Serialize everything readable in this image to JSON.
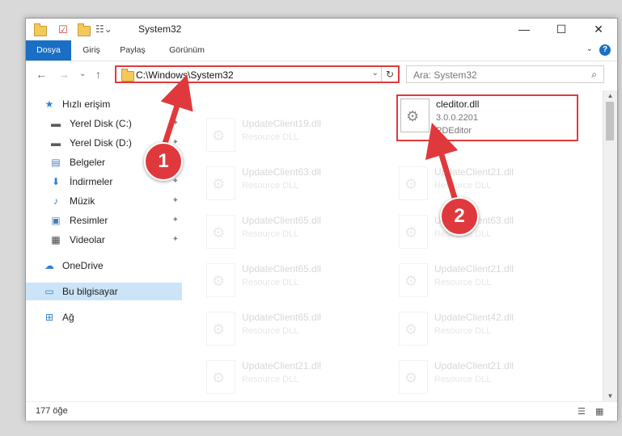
{
  "window": {
    "title": "System32",
    "minimize_glyph": "—",
    "maximize_glyph": "☐",
    "close_glyph": "✕"
  },
  "ribbon": {
    "tabs": [
      "Dosya",
      "Giriş",
      "Paylaş",
      "Görünüm"
    ],
    "help_glyph": "?",
    "expand_glyph": "⌄"
  },
  "navigation": {
    "back_glyph": "←",
    "forward_glyph": "→",
    "recent_glyph": "⌄",
    "up_glyph": "↑",
    "address": "C:\\Windows\\System32",
    "address_dropdown_glyph": "⌄",
    "refresh_glyph": "↻",
    "search_placeholder": "Ara: System32",
    "search_glyph": "⌕"
  },
  "sidebar": {
    "items": [
      {
        "label": "Hızlı erişim",
        "icon": "star-icon",
        "glyph": "★",
        "color": "#2f7fd6"
      },
      {
        "label": "Yerel Disk (C:)",
        "icon": "drive-icon",
        "glyph": "▬",
        "color": "#5a5a5a",
        "pinned": true
      },
      {
        "label": "Yerel Disk (D:)",
        "icon": "drive-icon",
        "glyph": "▬",
        "color": "#5a5a5a",
        "pinned": true
      },
      {
        "label": "Belgeler",
        "icon": "documents-icon",
        "glyph": "▤",
        "color": "#4a7bb7",
        "pinned": true
      },
      {
        "label": "İndirmeler",
        "icon": "download-icon",
        "glyph": "⬇",
        "color": "#2f7fd6",
        "pinned": true
      },
      {
        "label": "Müzik",
        "icon": "music-icon",
        "glyph": "♪",
        "color": "#2f7fd6",
        "pinned": true
      },
      {
        "label": "Resimler",
        "icon": "pictures-icon",
        "glyph": "▣",
        "color": "#4a7bb7",
        "pinned": true
      },
      {
        "label": "Videolar",
        "icon": "videos-icon",
        "glyph": "▦",
        "color": "#444",
        "pinned": true
      },
      {
        "label": "OneDrive",
        "icon": "cloud-icon",
        "glyph": "☁",
        "color": "#2f7fd6"
      },
      {
        "label": "Bu bilgisayar",
        "icon": "computer-icon",
        "glyph": "▭",
        "color": "#2f7fd6",
        "selected": true
      },
      {
        "label": "Ağ",
        "icon": "network-icon",
        "glyph": "⊞",
        "color": "#2f7fd6"
      }
    ],
    "pin_glyph": "✦"
  },
  "files": {
    "left_column": [
      {
        "name": "UpdateClient19.dll",
        "type": "Resource DLL"
      },
      {
        "name": "UpdateClient63.dll",
        "type": "Resource DLL"
      },
      {
        "name": "UpdateClient65.dll",
        "type": "Resource DLL"
      },
      {
        "name": "UpdateClient65.dll",
        "type": "Resource DLL"
      },
      {
        "name": "UpdateClient65.dll",
        "type": "Resource DLL"
      },
      {
        "name": "UpdateClient21.dll",
        "type": "Resource DLL"
      }
    ],
    "highlighted": {
      "name": "cleditor.dll",
      "version": "3.0.0.2201",
      "company": "PDEditor"
    },
    "right_column": [
      {
        "name": "UpdateClient21.dll",
        "type": "Resource DLL"
      },
      {
        "name": "UpdateClient63.dll",
        "type": "Resource DLL"
      },
      {
        "name": "UpdateClient21.dll",
        "type": "Resource DLL"
      },
      {
        "name": "UpdateClient42.dll",
        "type": "Resource DLL"
      },
      {
        "name": "UpdateClient21.dll",
        "type": "Resource DLL"
      }
    ],
    "gear_glyph": "⚙"
  },
  "status": {
    "item_count": "177 öğe",
    "details_view_glyph": "☰",
    "tiles_view_glyph": "▦"
  },
  "callouts": {
    "one": "1",
    "two": "2",
    "color": "#e0393d"
  }
}
